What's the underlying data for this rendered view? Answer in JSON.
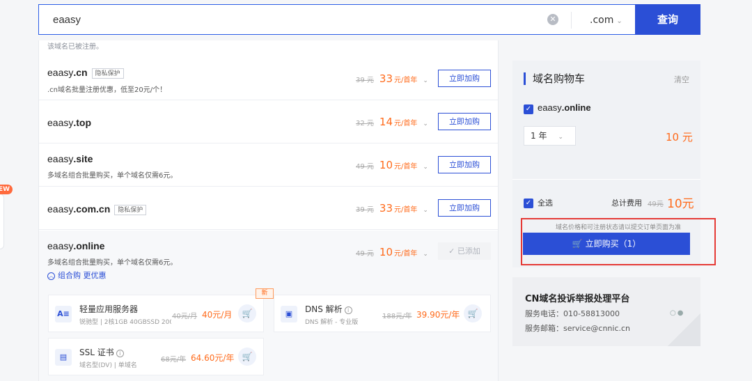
{
  "search": {
    "query": "eaasy",
    "suffix": ".com",
    "button_label": "查询",
    "clear_icon": "close-circle-icon"
  },
  "left_badge": "NEW",
  "results": {
    "top_note": "该域名已被注册。",
    "rows": [
      {
        "name_prefix": "eaasy",
        "name_tld": ".cn",
        "tag": "隐私保护",
        "desc": ".cn域名批量注册优惠，低至20元/个！",
        "orig_price": "39 元",
        "price": "33",
        "unit": "元/首年",
        "button": "立即加购"
      },
      {
        "name_prefix": "eaasy",
        "name_tld": ".top",
        "tag": "",
        "desc": "",
        "orig_price": "32 元",
        "price": "14",
        "unit": "元/首年",
        "button": "立即加购"
      },
      {
        "name_prefix": "eaasy",
        "name_tld": ".site",
        "tag": "",
        "desc": "多域名组合批量购买，单个域名仅需6元。",
        "orig_price": "49 元",
        "price": "10",
        "unit": "元/首年",
        "button": "立即加购"
      },
      {
        "name_prefix": "eaasy",
        "name_tld": ".com.cn",
        "tag": "隐私保护",
        "desc": "",
        "orig_price": "39 元",
        "price": "33",
        "unit": "元/首年",
        "button": "立即加购"
      },
      {
        "name_prefix": "eaasy",
        "name_tld": ".online",
        "tag": "",
        "desc": "多域名组合批量购买，单个域名仅需6元。",
        "orig_price": "49 元",
        "price": "10",
        "unit": "元/首年",
        "button": "已添加"
      }
    ],
    "combo_link": "组合购 更优惠",
    "new_tag": "新",
    "products": [
      {
        "name": "轻量应用服务器",
        "spec": "锐驰型 | 2核1GB 40GBSSD 200",
        "orig": "40元/月",
        "price": "40元/月",
        "icon": "server-icon",
        "glyph": "A≡"
      },
      {
        "name": "DNS 解析",
        "spec": "DNS 解析 - 专业版",
        "orig": "188元/年",
        "price": "39.90元/年",
        "icon": "dns-icon",
        "glyph": "▣"
      },
      {
        "name": "SSL 证书",
        "spec": "域名型(DV) | 单域名",
        "orig": "68元/年",
        "price": "64.60元/年",
        "icon": "certificate-icon",
        "glyph": "▤"
      }
    ]
  },
  "cart": {
    "title": "域名购物车",
    "clear": "清空",
    "item_name_prefix": "eaasy",
    "item_name_tld": ".online",
    "year": "1 年",
    "item_price": "10 元",
    "select_all": "全选",
    "total_label": "总计费用",
    "total_orig": "49元",
    "total_price": "10元",
    "note": "域名价格和可注册状态请以提交订单页面为准",
    "purchase_button": "立即购买（1）"
  },
  "report": {
    "title": "CN域名投诉举报处理平台",
    "phone": "服务电话：010-58813000",
    "email": "服务邮箱：service@cnnic.cn"
  },
  "colors": {
    "accent": "#2b4fd6",
    "price": "#ff6a1a",
    "highlight": "#e53935"
  }
}
